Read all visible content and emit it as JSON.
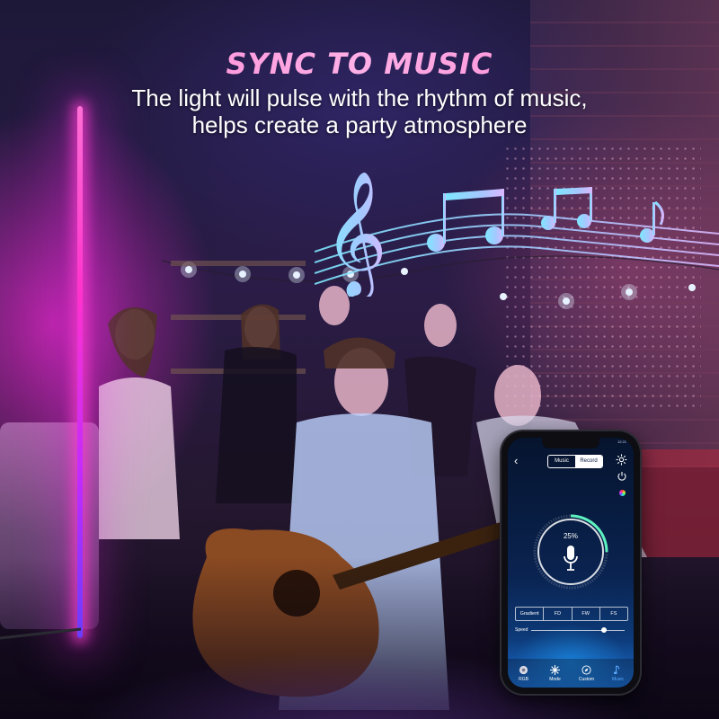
{
  "headline": "SYNC TO MUSIC",
  "subline_1": "The light will pulse with the rhythm of music,",
  "subline_2": "helps create a party atmosphere",
  "accent_colors": {
    "headline": "#ff8fd6",
    "lamp": "#ff33cc",
    "notes": "#7ee6ff"
  },
  "phone_app": {
    "status_time": "12:21",
    "segment": {
      "options": [
        "Music",
        "Record"
      ],
      "selected": "Record"
    },
    "level_percent_label": "25%",
    "level_fraction": 0.25,
    "mode_buttons": [
      "Gradient",
      "FD",
      "FW",
      "FS"
    ],
    "speed_label": "Speed",
    "speed_fraction": 0.78,
    "tabs": [
      {
        "label": "RGB",
        "icon": "color-wheel-icon"
      },
      {
        "label": "Mode",
        "icon": "snowflake-icon"
      },
      {
        "label": "Custom",
        "icon": "compass-icon"
      },
      {
        "label": "Music",
        "icon": "music-note-icon",
        "active": true
      }
    ]
  }
}
